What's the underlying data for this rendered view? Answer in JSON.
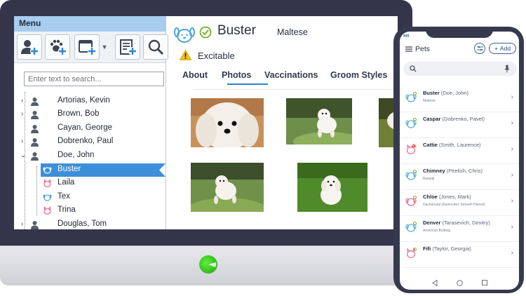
{
  "desktop": {
    "menu_title": "Menu",
    "search_placeholder": "Enter text to search...",
    "tree": [
      {
        "label": "Artorias, Kevin",
        "expanded": false
      },
      {
        "label": "Brown, Bob",
        "expanded": false
      },
      {
        "label": "Cayan, George",
        "expanded": null
      },
      {
        "label": "Dobrenko, Paul",
        "expanded": false
      },
      {
        "label": "Doe, John",
        "expanded": true
      },
      {
        "label": "Buster",
        "selected": true
      },
      {
        "label": "Laila"
      },
      {
        "label": "Tex"
      },
      {
        "label": "Trina"
      },
      {
        "label": "Douglas, Tom",
        "expanded": false
      }
    ],
    "pet": {
      "name": "Buster",
      "breed": "Maltese",
      "alert": "Excitable"
    },
    "tabs": [
      "About",
      "Photos",
      "Vaccinations",
      "Groom Styles"
    ],
    "active_tab": "Photos",
    "photos": [
      "photo-1",
      "photo-2",
      "photo-3",
      "photo-4",
      "photo-5"
    ],
    "accent_color": "#3c8fd8"
  },
  "mobile": {
    "title": "Pets",
    "add_label": "Add",
    "pets": [
      {
        "name": "Buster",
        "owner": "(Doe, John)",
        "breed": "Maltese",
        "color": "#4fa6d8"
      },
      {
        "name": "Caspar",
        "owner": "(Dobrenko, Pavel)",
        "breed": "",
        "color": "#4fa6d8"
      },
      {
        "name": "Cattie",
        "owner": "(Smith, Laurence)",
        "breed": "",
        "color": "#e5608a"
      },
      {
        "name": "Chimney",
        "owner": "(Peelish, Chris)",
        "breed": "Basenji",
        "color": "#4fa6d8"
      },
      {
        "name": "Chloe",
        "owner": "(Jones, Mark)",
        "breed": "Dachshund (Kaninchen Smooth Haired)",
        "color": "#e5608a"
      },
      {
        "name": "Denver",
        "owner": "(Tarasevich, Dimitry)",
        "breed": "American Bulldog",
        "color": "#4fa6d8"
      },
      {
        "name": "Fifi",
        "owner": "(Taylor, Georgia)",
        "breed": "",
        "color": "#e5608a"
      }
    ]
  }
}
